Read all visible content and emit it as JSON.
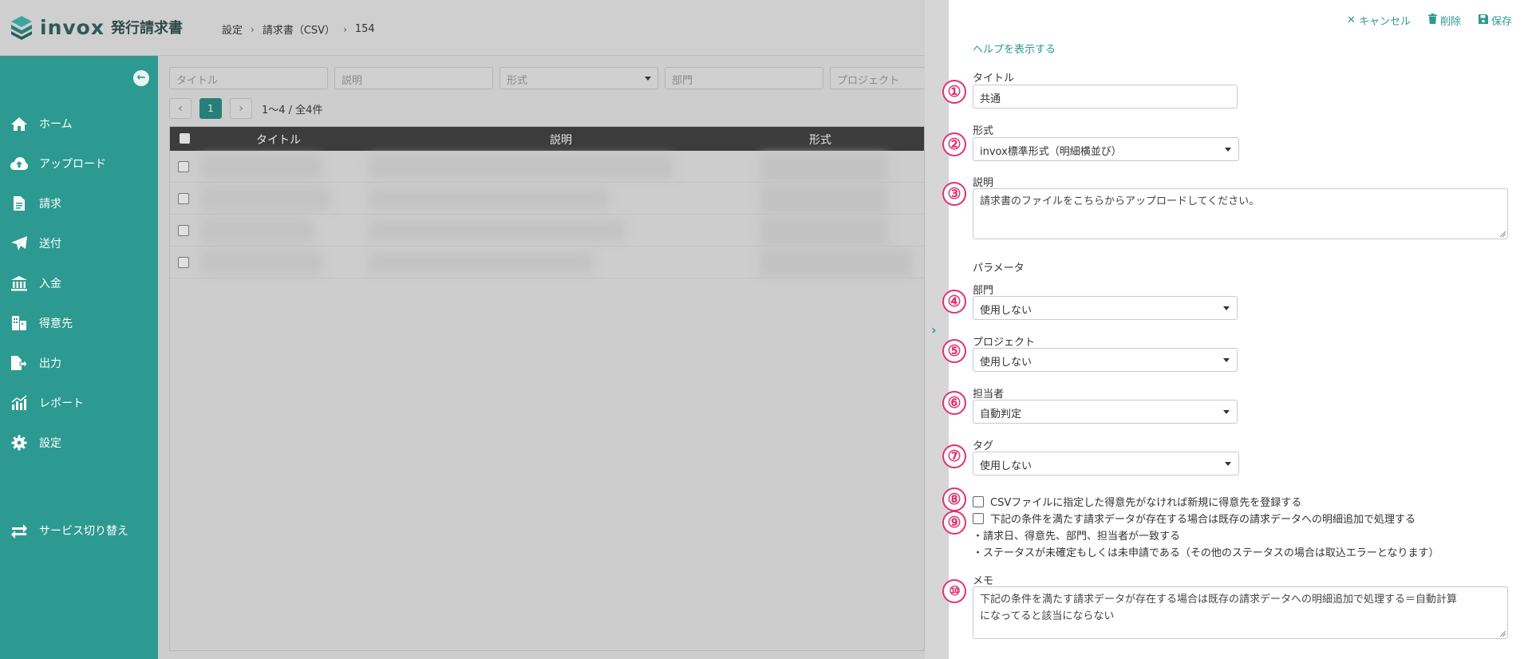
{
  "header": {
    "logo_text": "invox",
    "logo_sub": "発行請求書",
    "breadcrumb": [
      "設定",
      "請求書（CSV）",
      "154"
    ]
  },
  "sidebar": {
    "items": [
      {
        "label": "ホーム",
        "icon": "home-icon"
      },
      {
        "label": "アップロード",
        "icon": "cloud-upload-icon"
      },
      {
        "label": "請求",
        "icon": "document-icon"
      },
      {
        "label": "送付",
        "icon": "paper-plane-icon"
      },
      {
        "label": "入金",
        "icon": "bank-icon"
      },
      {
        "label": "得意先",
        "icon": "building-icon"
      },
      {
        "label": "出力",
        "icon": "file-export-icon"
      },
      {
        "label": "レポート",
        "icon": "chart-icon"
      },
      {
        "label": "設定",
        "icon": "gear-icon"
      }
    ],
    "switch_label": "サービス切り替え"
  },
  "main": {
    "filters": [
      {
        "placeholder": "タイトル"
      },
      {
        "placeholder": "説明"
      },
      {
        "placeholder": "形式"
      },
      {
        "placeholder": "部門"
      },
      {
        "placeholder": "プロジェクト"
      }
    ],
    "pager": {
      "current": "1",
      "info": "1〜4 / 全4件"
    },
    "table": {
      "columns": [
        "タイトル",
        "説明",
        "形式"
      ],
      "row_count": 4
    }
  },
  "panel": {
    "actions": {
      "cancel": "キャンセル",
      "delete": "削除",
      "save": "保存"
    },
    "help_link": "ヘルプを表示する",
    "title_label": "タイトル",
    "title_value": "共通",
    "format_label": "形式",
    "format_value": "invox標準形式（明細横並び）",
    "description_label": "説明",
    "description_value": "請求書のファイルをこちらからアップロードしてください。",
    "params_label": "パラメータ",
    "department_label": "部門",
    "department_value": "使用しない",
    "project_label": "プロジェクト",
    "project_value": "使用しない",
    "assignee_label": "担当者",
    "assignee_value": "自動判定",
    "tag_label": "タグ",
    "tag_value": "使用しない",
    "check_register_customer": "CSVファイルに指定した得意先がなければ新規に得意先を登録する",
    "check_merge_invoice": "下記の条件を満たす請求データが存在する場合は既存の請求データへの明細追加で処理する",
    "note_1": "・請求日、得意先、部門、担当者が一致する",
    "note_2": "・ステータスが未確定もしくは未申請である（その他のステータスの場合は取込エラーとなります）",
    "memo_label": "メモ",
    "memo_line_1": "下記の条件を満たす請求データが存在する場合は既存の請求データへの明細追加で処理する＝自動計算",
    "memo_line_2": "になってると該当にならない"
  },
  "annotations": [
    "①",
    "②",
    "③",
    "④",
    "⑤",
    "⑥",
    "⑦",
    "⑧",
    "⑨",
    "⑩"
  ],
  "colors": {
    "accent": "#2c9a91",
    "annotation": "#e0336e"
  }
}
